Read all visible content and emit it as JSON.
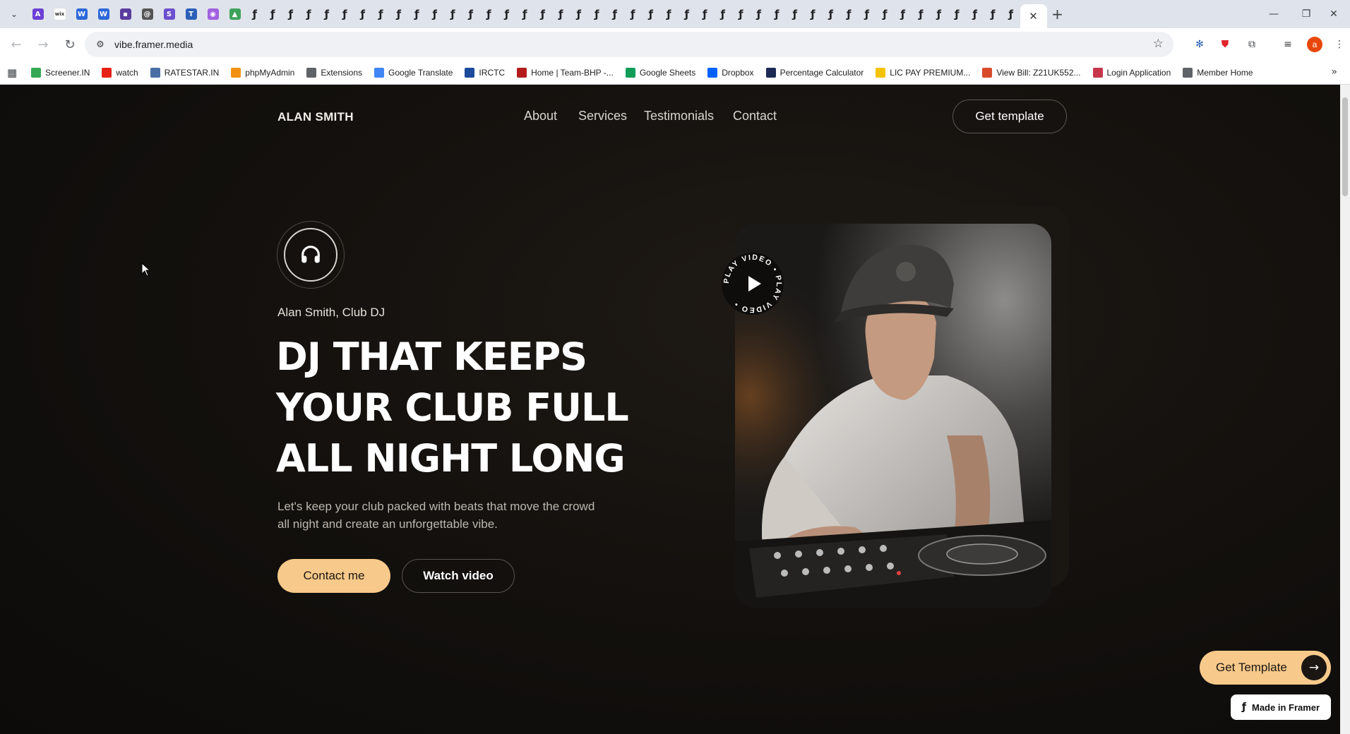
{
  "browser": {
    "url": "vibe.framer.media",
    "tab_close_glyph": "✕",
    "new_tab_glyph": "+",
    "profile_initial": "a",
    "pinned_tabs": [
      {
        "icon": "framer-purple-icon",
        "color": "#6b3fd4",
        "glyph": "A"
      },
      {
        "icon": "wix-icon",
        "color": "#ffffff",
        "glyph": "wix"
      },
      {
        "icon": "wave-blue-icon",
        "color": "#2b67d9",
        "glyph": "W"
      },
      {
        "icon": "wave-blue-icon",
        "color": "#2b67d9",
        "glyph": "W"
      },
      {
        "icon": "purple-square-icon",
        "color": "#5b3d9e",
        "glyph": "▪"
      },
      {
        "icon": "spiral-icon",
        "color": "#555555",
        "glyph": "@"
      },
      {
        "icon": "shortcut-icon",
        "color": "#6b4fcf",
        "glyph": "S"
      },
      {
        "icon": "table-icon",
        "color": "#2b5fb7",
        "glyph": "T"
      },
      {
        "icon": "eye-icon",
        "color": "#a060e0",
        "glyph": "◉"
      },
      {
        "icon": "leaf-icon",
        "color": "#3ea35a",
        "glyph": "▲"
      }
    ],
    "framer_tab_count": 43,
    "framer_glyph": "ƒ"
  },
  "bookmarks": [
    {
      "label": "Screener.IN",
      "icon": "bars-icon",
      "color": "#34a853"
    },
    {
      "label": "watch",
      "icon": "youtube-icon",
      "color": "#e62117"
    },
    {
      "label": "RATESTAR.IN",
      "icon": "ratestar-icon",
      "color": "#4a6fa5"
    },
    {
      "label": "phpMyAdmin",
      "icon": "phpmyadmin-icon",
      "color": "#f29111"
    },
    {
      "label": "Extensions",
      "icon": "puzzle-icon",
      "color": "#5f6368"
    },
    {
      "label": "Google Translate",
      "icon": "translate-icon",
      "color": "#4285f4"
    },
    {
      "label": "IRCTC",
      "icon": "irctc-icon",
      "color": "#1c4a9c"
    },
    {
      "label": "Home | Team-BHP -...",
      "icon": "teambhp-icon",
      "color": "#b41c1c"
    },
    {
      "label": "Google Sheets",
      "icon": "sheets-icon",
      "color": "#0f9d58"
    },
    {
      "label": "Dropbox",
      "icon": "dropbox-icon",
      "color": "#0061fe"
    },
    {
      "label": "Percentage Calculator",
      "icon": "calculator-icon",
      "color": "#1c2a55"
    },
    {
      "label": "LIC PAY PREMIUM...",
      "icon": "lic-icon",
      "color": "#f4c300"
    },
    {
      "label": "View Bill: Z21UK552...",
      "icon": "bill-icon",
      "color": "#d94a2b"
    },
    {
      "label": "Login Application",
      "icon": "login-icon",
      "color": "#c8364c"
    },
    {
      "label": "Member Home",
      "icon": "globe-icon",
      "color": "#5f6368"
    }
  ],
  "site": {
    "brand": "ALAN SMITH",
    "nav": [
      "About",
      "Services",
      "Testimonials",
      "Contact"
    ],
    "cta_top": "Get template",
    "subtitle": "Alan Smith, Club DJ",
    "headline": [
      "DJ THAT KEEPS",
      "YOUR CLUB FULL",
      "ALL NIGHT LONG"
    ],
    "description": [
      "Let's keep your club packed with beats that move the crowd",
      "all night and create an unforgettable vibe."
    ],
    "btn_contact": "Contact me",
    "btn_watch": "Watch video",
    "play_badge_text": "PLAY VIDEO • PLAY VIDEO • ",
    "fab_label": "Get Template",
    "made_in": "Made in Framer",
    "accent": "#f7c98a",
    "background": "#0f0d0b"
  }
}
